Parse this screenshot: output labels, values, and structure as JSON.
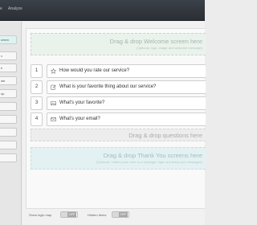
{
  "topbar": {
    "nav_first": "e",
    "nav_second": "Analyze"
  },
  "sidebar": {
    "items": [
      {
        "label": "creen",
        "active": true
      },
      {
        "label": "x",
        "active": false
      },
      {
        "label": "k",
        "active": false
      },
      {
        "label": "ste",
        "active": false
      },
      {
        "label": "op",
        "active": false
      },
      {
        "label": "",
        "active": false
      },
      {
        "label": "",
        "active": false
      },
      {
        "label": "",
        "active": false
      },
      {
        "label": "",
        "active": false
      },
      {
        "label": "",
        "active": false
      }
    ]
  },
  "welcome_zone": {
    "title": "Drag & drop Welcome screen here",
    "subtitle": "(Optional, logo, image and welcome message)"
  },
  "questions": [
    {
      "number": "1",
      "icon": "star-icon",
      "text": "How would you rate our service?"
    },
    {
      "number": "2",
      "icon": "edit-icon",
      "text": "What is your favorite thing about our service?"
    },
    {
      "number": "3",
      "icon": "image-icon",
      "text": "What's your favorite?"
    },
    {
      "number": "4",
      "icon": "email-icon",
      "text": "What's your email?"
    }
  ],
  "questions_zone": {
    "title": "Drag & drop questions here"
  },
  "thanks_zone": {
    "title": "Drag & drop Thank You screens here",
    "subtitle": "(Optional, redirect your user to a webpage, logic and thank you messages)"
  },
  "footer": {
    "logic_map_label": "Show logic map",
    "logic_map_toggle": "OFF",
    "hidden_items_label": "Hidden items",
    "hidden_items_toggle": "OFF"
  },
  "colors": {
    "topbar": "#2f353b",
    "welcome_bg": "#e9f3ec",
    "thanks_bg": "#e3f1f2",
    "sidebar_active": "#dff2ef"
  }
}
